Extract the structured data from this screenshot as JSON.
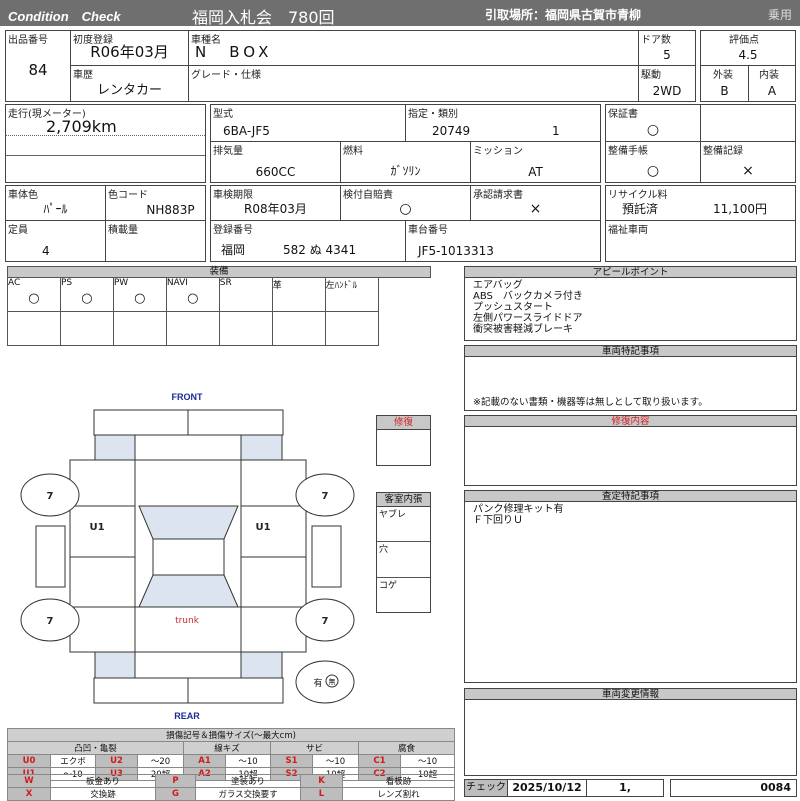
{
  "header": {
    "brand": "Condition　Check",
    "auction": "福岡入札会　780回",
    "pickup": "引取場所：福岡県古賀市青柳",
    "category": "乗用"
  },
  "vehicle": {
    "lot_label": "出品番号",
    "lot": "84",
    "first_reg_label": "初度登録",
    "first_reg": "R06年03月",
    "model_label": "車種名",
    "model": "N　BOX",
    "history_label": "車歴",
    "history": "レンタカー",
    "grade_label": "グレード・仕様",
    "doors_label": "ドア数",
    "doors": "5",
    "drive_label": "駆動",
    "drive": "2WD",
    "score_label": "評価点",
    "score": "4.5",
    "exterior_label": "外装",
    "exterior": "B",
    "interior_label": "内装",
    "interior": "A"
  },
  "specs": {
    "mileage_label": "走行(現メーター)",
    "mileage": "2,709km",
    "type_label": "型式",
    "type": "6BA-JF5",
    "class_label": "指定・類別",
    "class_no": "20749",
    "class_sub": "1",
    "displacement_label": "排気量",
    "displacement": "660CC",
    "fuel_label": "燃料",
    "fuel": "ｶﾞｿﾘﾝ",
    "mission_label": "ミッション",
    "mission": "AT",
    "warranty_label": "保証書",
    "warranty": "○",
    "manual_label": "整備手帳",
    "manual": "○",
    "records_label": "整備記録",
    "records": "×",
    "color_label": "車体色",
    "color": "ﾊﾟｰﾙ",
    "color_code_label": "色コード",
    "color_code": "NH883P",
    "inspection_label": "車検期限",
    "inspection": "R08年03月",
    "insurance_label": "検付自賠責",
    "insurance": "○",
    "approval_label": "承認請求書",
    "approval": "×",
    "recycle_label": "リサイクル料",
    "recycle_status": "預託済",
    "recycle_fee": "11,100円",
    "capacity_label": "定員",
    "capacity": "4",
    "load_label": "積載量",
    "plate_label": "登録番号",
    "plate_area": "福岡",
    "plate_num": "582 ぬ 4341",
    "chassis_label": "車台番号",
    "chassis": "JF5-1013313",
    "welfare_label": "福祉車両"
  },
  "equipment": {
    "title": "装備",
    "items": [
      {
        "label": "AC",
        "value": "○"
      },
      {
        "label": "PS",
        "value": "○"
      },
      {
        "label": "PW",
        "value": "○"
      },
      {
        "label": "NAVI",
        "value": "○"
      },
      {
        "label": "SR",
        "value": ""
      },
      {
        "label": "革",
        "value": ""
      },
      {
        "label": "左ﾊﾝﾄﾞﾙ",
        "value": ""
      }
    ]
  },
  "panels": {
    "appeal_title": "アピールポイント",
    "appeal": [
      "エアバッグ",
      "ABS　バックカメラ付き",
      "プッシュスタート",
      "左側パワースライドドア",
      "衝突被害軽減ブレーキ"
    ],
    "notes_title": "車両特記事項",
    "notes_footer": "※記載のない書類・機器等は無しとして取り扱います。",
    "repair_title": "修復内容",
    "assess_title": "査定特記事項",
    "assess": [
      "パンク修理キット有",
      "Ｆ下回りＵ"
    ],
    "change_title": "車両変更情報"
  },
  "footer": {
    "check_label": "チェック",
    "date": "2025/10/12",
    "num": "1,",
    "code": "0084"
  },
  "diagram": {
    "front": "FRONT",
    "rear": "REAR",
    "trunk": "trunk",
    "tires": [
      "7",
      "7",
      "7",
      "7"
    ],
    "damage_left": "U1",
    "damage_right": "U1",
    "spare_have": "有",
    "spare_none": "無",
    "repair_title": "修復",
    "interior_title": "客室内張",
    "interior_items": [
      "ヤブレ",
      "穴",
      "コゲ"
    ]
  },
  "legend": {
    "title": "損傷記号＆損傷サイズ(～最大cm)",
    "cats": [
      "凸凹・亀裂",
      "線キズ",
      "サビ",
      "腐食"
    ],
    "row1": [
      [
        "U0",
        "エクボ"
      ],
      [
        "U2",
        "～20"
      ],
      [
        "A1",
        "～10"
      ],
      [
        "S1",
        "～10"
      ],
      [
        "C1",
        "～10"
      ]
    ],
    "row2": [
      [
        "U1",
        "～10"
      ],
      [
        "U3",
        "20超"
      ],
      [
        "A2",
        "10超"
      ],
      [
        "S2",
        "10超"
      ],
      [
        "C2",
        "10超"
      ]
    ],
    "row3": [
      [
        "W",
        "板金あり"
      ],
      [
        "P",
        "塗装あり"
      ],
      [
        "K",
        "看板跡"
      ]
    ],
    "row4": [
      [
        "X",
        "交換跡"
      ],
      [
        "G",
        "ガラス交換要す"
      ],
      [
        "L",
        "レンズ割れ"
      ]
    ]
  },
  "colors": {
    "header": "#6f6f6f",
    "accent_red": "#d42020",
    "glass": "#dbe4ef",
    "blue_text": "#1a2a9a"
  }
}
